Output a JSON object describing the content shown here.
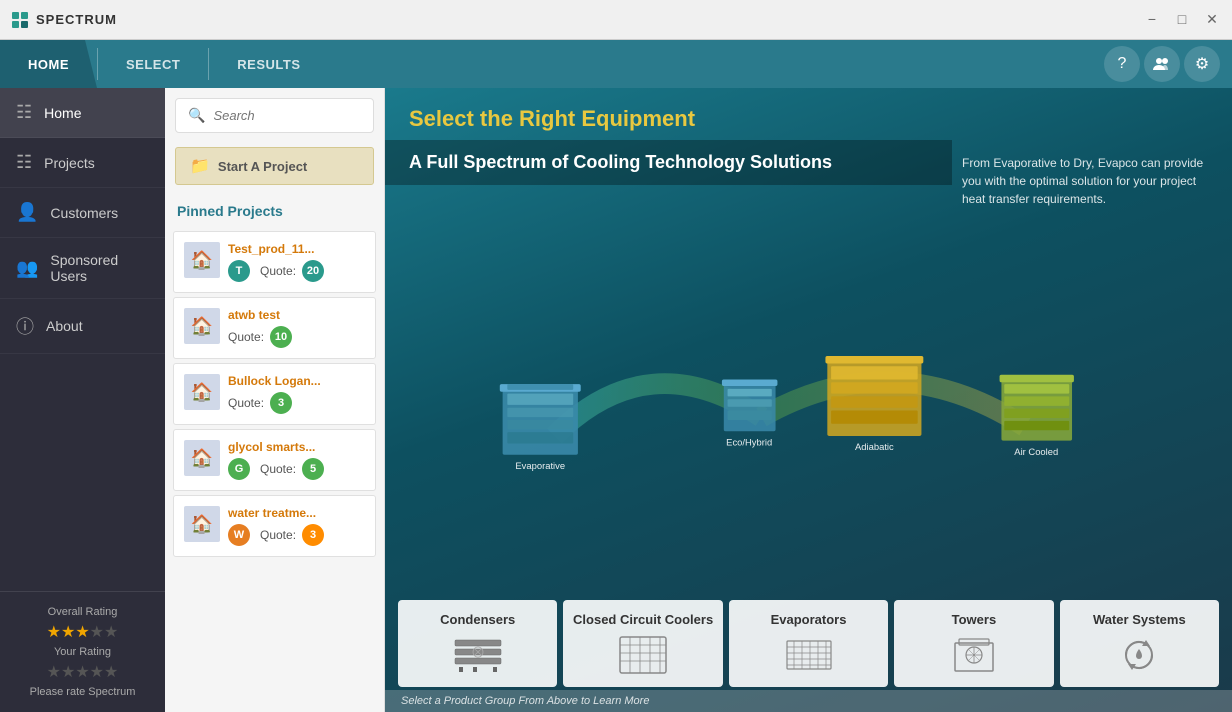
{
  "titleBar": {
    "appName": "SPECTRUM",
    "controls": [
      "minimize",
      "maximize",
      "close"
    ]
  },
  "tabs": [
    {
      "id": "home",
      "label": "HOME",
      "active": true
    },
    {
      "id": "select",
      "label": "SELECT",
      "active": false
    },
    {
      "id": "results",
      "label": "RESULTS",
      "active": false
    }
  ],
  "tabIcons": [
    "help",
    "users",
    "settings"
  ],
  "sidebar": {
    "items": [
      {
        "id": "home",
        "label": "Home",
        "icon": "grid"
      },
      {
        "id": "projects",
        "label": "Projects",
        "icon": "list"
      },
      {
        "id": "customers",
        "label": "Customers",
        "icon": "person"
      },
      {
        "id": "sponsored",
        "label": "Sponsored Users",
        "icon": "person-add"
      },
      {
        "id": "about",
        "label": "About",
        "icon": "info"
      }
    ],
    "rating": {
      "label": "Overall Rating",
      "yourRatingLabel": "Your Rating",
      "pleaseRate": "Please rate Spectrum",
      "overallStars": 3,
      "yourStars": 0,
      "maxStars": 5
    }
  },
  "leftPanel": {
    "search": {
      "placeholder": "Search"
    },
    "startProject": {
      "label": "Start A Project"
    },
    "pinnedProjects": {
      "header": "Pinned Projects",
      "items": [
        {
          "name": "Test_prod_11...",
          "quote": "Quote:",
          "count": 20,
          "badgeColor": "teal",
          "avatar": "T",
          "avatarColor": "avatar-T"
        },
        {
          "name": "atwb test",
          "quote": "Quote:",
          "count": 10,
          "badgeColor": "green",
          "avatar": null,
          "avatarColor": null
        },
        {
          "name": "Bullock Logan...",
          "quote": "Quote:",
          "count": 3,
          "badgeColor": "green",
          "avatar": null,
          "avatarColor": null
        },
        {
          "name": "glycol smarts...",
          "quote": "Quote:",
          "count": 5,
          "badgeColor": "green",
          "avatar": "G",
          "avatarColor": "avatar-G"
        },
        {
          "name": "water treatme...",
          "quote": "Quote:",
          "count": 3,
          "badgeColor": "orange",
          "avatar": "W",
          "avatarColor": "avatar-W"
        }
      ]
    }
  },
  "mainContent": {
    "title": "Select the Right Equipment",
    "subtitle": "A Full Spectrum of Cooling Technology Solutions",
    "description": "From Evaporative to Dry, Evapco can provide you with the optimal solution for your project heat transfer requirements.",
    "categories": [
      {
        "id": "condensers",
        "name": "Condensers"
      },
      {
        "id": "closed-circuit-coolers",
        "name": "Closed Circuit Coolers"
      },
      {
        "id": "evaporators",
        "name": "Evaporators"
      },
      {
        "id": "towers",
        "name": "Towers"
      },
      {
        "id": "water-systems",
        "name": "Water Systems"
      }
    ],
    "statusBar": "Select a Product Group From Above to Learn More",
    "vizLabels": {
      "evaporative": "Evaporative",
      "ecoHybrid": "Eco/Hybrid",
      "adiabatic": "Adiabatic",
      "airCooled": "Air Cooled"
    }
  }
}
